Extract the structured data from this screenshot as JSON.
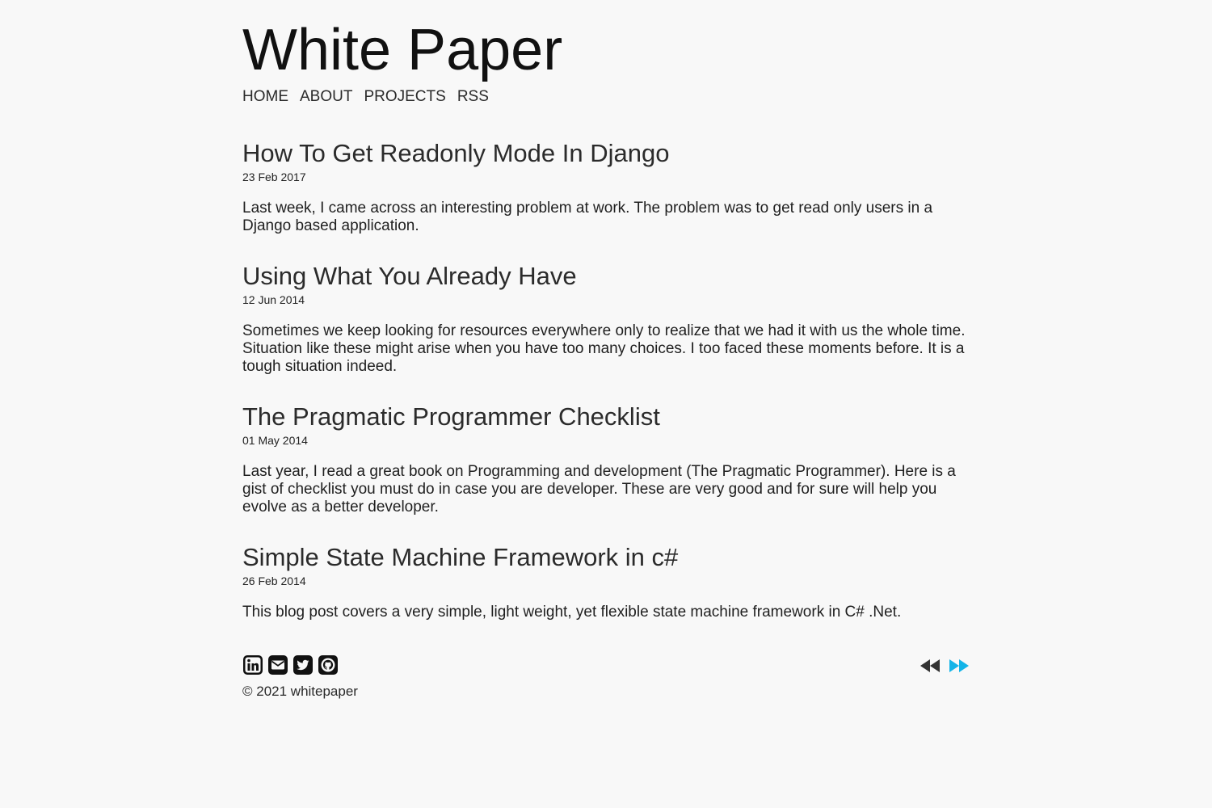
{
  "site": {
    "title": "White Paper"
  },
  "nav": {
    "items": [
      {
        "label": "HOME"
      },
      {
        "label": "ABOUT"
      },
      {
        "label": "PROJECTS"
      },
      {
        "label": "RSS"
      }
    ]
  },
  "posts": [
    {
      "title": "How To Get Readonly Mode In Django",
      "date": "23 Feb 2017",
      "excerpt": "Last week, I came across an interesting problem at work. The problem was to get read only users in a Django based application."
    },
    {
      "title": "Using What You Already Have",
      "date": "12 Jun 2014",
      "excerpt": "Sometimes we keep looking for resources everywhere only to realize that we had it with us the whole time. Situation like these might arise when you have too many choices. I too faced these moments before. It is a tough situation indeed."
    },
    {
      "title": "The Pragmatic Programmer Checklist",
      "date": "01 May 2014",
      "excerpt": "Last year, I read a great book on Programming and development (The Pragmatic Programmer). Here is a gist of checklist you must do in case you are developer. These are very good and for sure will help you evolve as a better developer."
    },
    {
      "title": "Simple State Machine Framework in c#",
      "date": "26 Feb 2014",
      "excerpt": "This blog post covers a very simple, light weight, yet flexible state machine framework in C# .Net."
    }
  ],
  "footer": {
    "social_icons": [
      "linkedin-icon",
      "email-icon",
      "twitter-icon",
      "github-icon"
    ],
    "copyright": "© 2021 whitepaper",
    "pager": {
      "prev_icon": "rewind-icon",
      "next_icon": "fast-forward-icon",
      "prev_color": "#333333",
      "next_color": "#13b4e8"
    }
  },
  "colors": {
    "background": "#f8f8f8",
    "text": "#1f1f1f",
    "accent": "#13b4e8"
  }
}
